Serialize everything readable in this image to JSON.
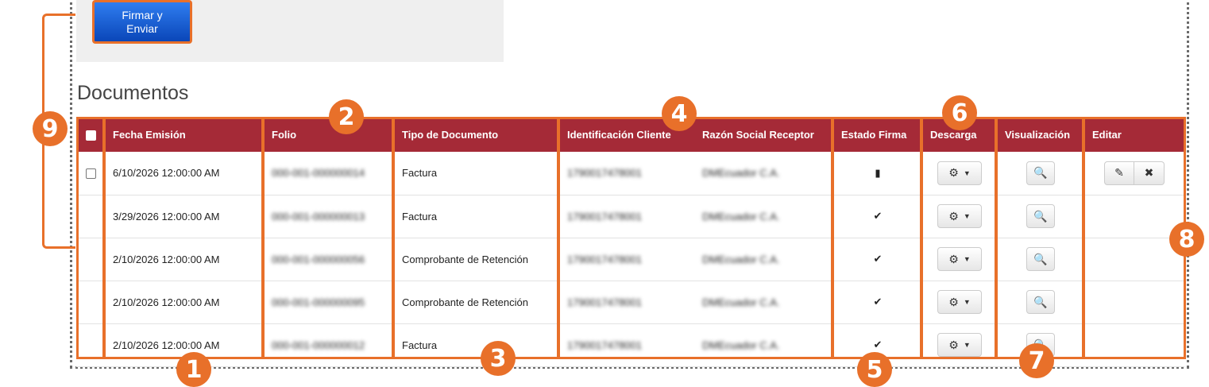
{
  "toolbar": {
    "sign_send_label": "Firmar y\nEnviar"
  },
  "section": {
    "title": "Documentos"
  },
  "table": {
    "columns": [
      "",
      "Fecha Emisión",
      "Folio",
      "Tipo de Documento",
      "Identificación Cliente",
      "Razón Social Receptor",
      "Estado Firma",
      "Descarga",
      "Visualización",
      "Editar"
    ],
    "rows": [
      {
        "fecha": "6/10/2026 12:00:00 AM",
        "folio": "000-001-000000014",
        "tipo": "Factura",
        "id_cliente": "1790017478001",
        "razon": "DMEcuador C.A.",
        "estado_icon": "file-icon"
      },
      {
        "fecha": "3/29/2026 12:00:00 AM",
        "folio": "000-001-000000013",
        "tipo": "Factura",
        "id_cliente": "1790017478001",
        "razon": "DMEcuador C.A.",
        "estado_icon": "check-icon"
      },
      {
        "fecha": "2/10/2026 12:00:00 AM",
        "folio": "000-001-000000056",
        "tipo": "Comprobante de Retención",
        "id_cliente": "1790017478001",
        "razon": "DMEcuador C.A.",
        "estado_icon": "check-icon"
      },
      {
        "fecha": "2/10/2026 12:00:00 AM",
        "folio": "000-001-000000095",
        "tipo": "Comprobante de Retención",
        "id_cliente": "1790017478001",
        "razon": "DMEcuador C.A.",
        "estado_icon": "check-icon"
      },
      {
        "fecha": "2/10/2026 12:00:00 AM",
        "folio": "000-001-000000012",
        "tipo": "Factura",
        "id_cliente": "1790017478001",
        "razon": "DMEcuador C.A.",
        "estado_icon": "check-icon"
      }
    ]
  },
  "icons": {
    "file": "▮",
    "check": "✔",
    "gear": "⚙",
    "caret": "▼",
    "zoom": "🔍",
    "edit": "✎",
    "delete": "✖"
  },
  "annotations": [
    "1",
    "2",
    "3",
    "4",
    "5",
    "6",
    "7",
    "8",
    "9"
  ],
  "colors": {
    "header": "#a52a37",
    "accent": "#e8702a",
    "button": "#0a46b8"
  }
}
